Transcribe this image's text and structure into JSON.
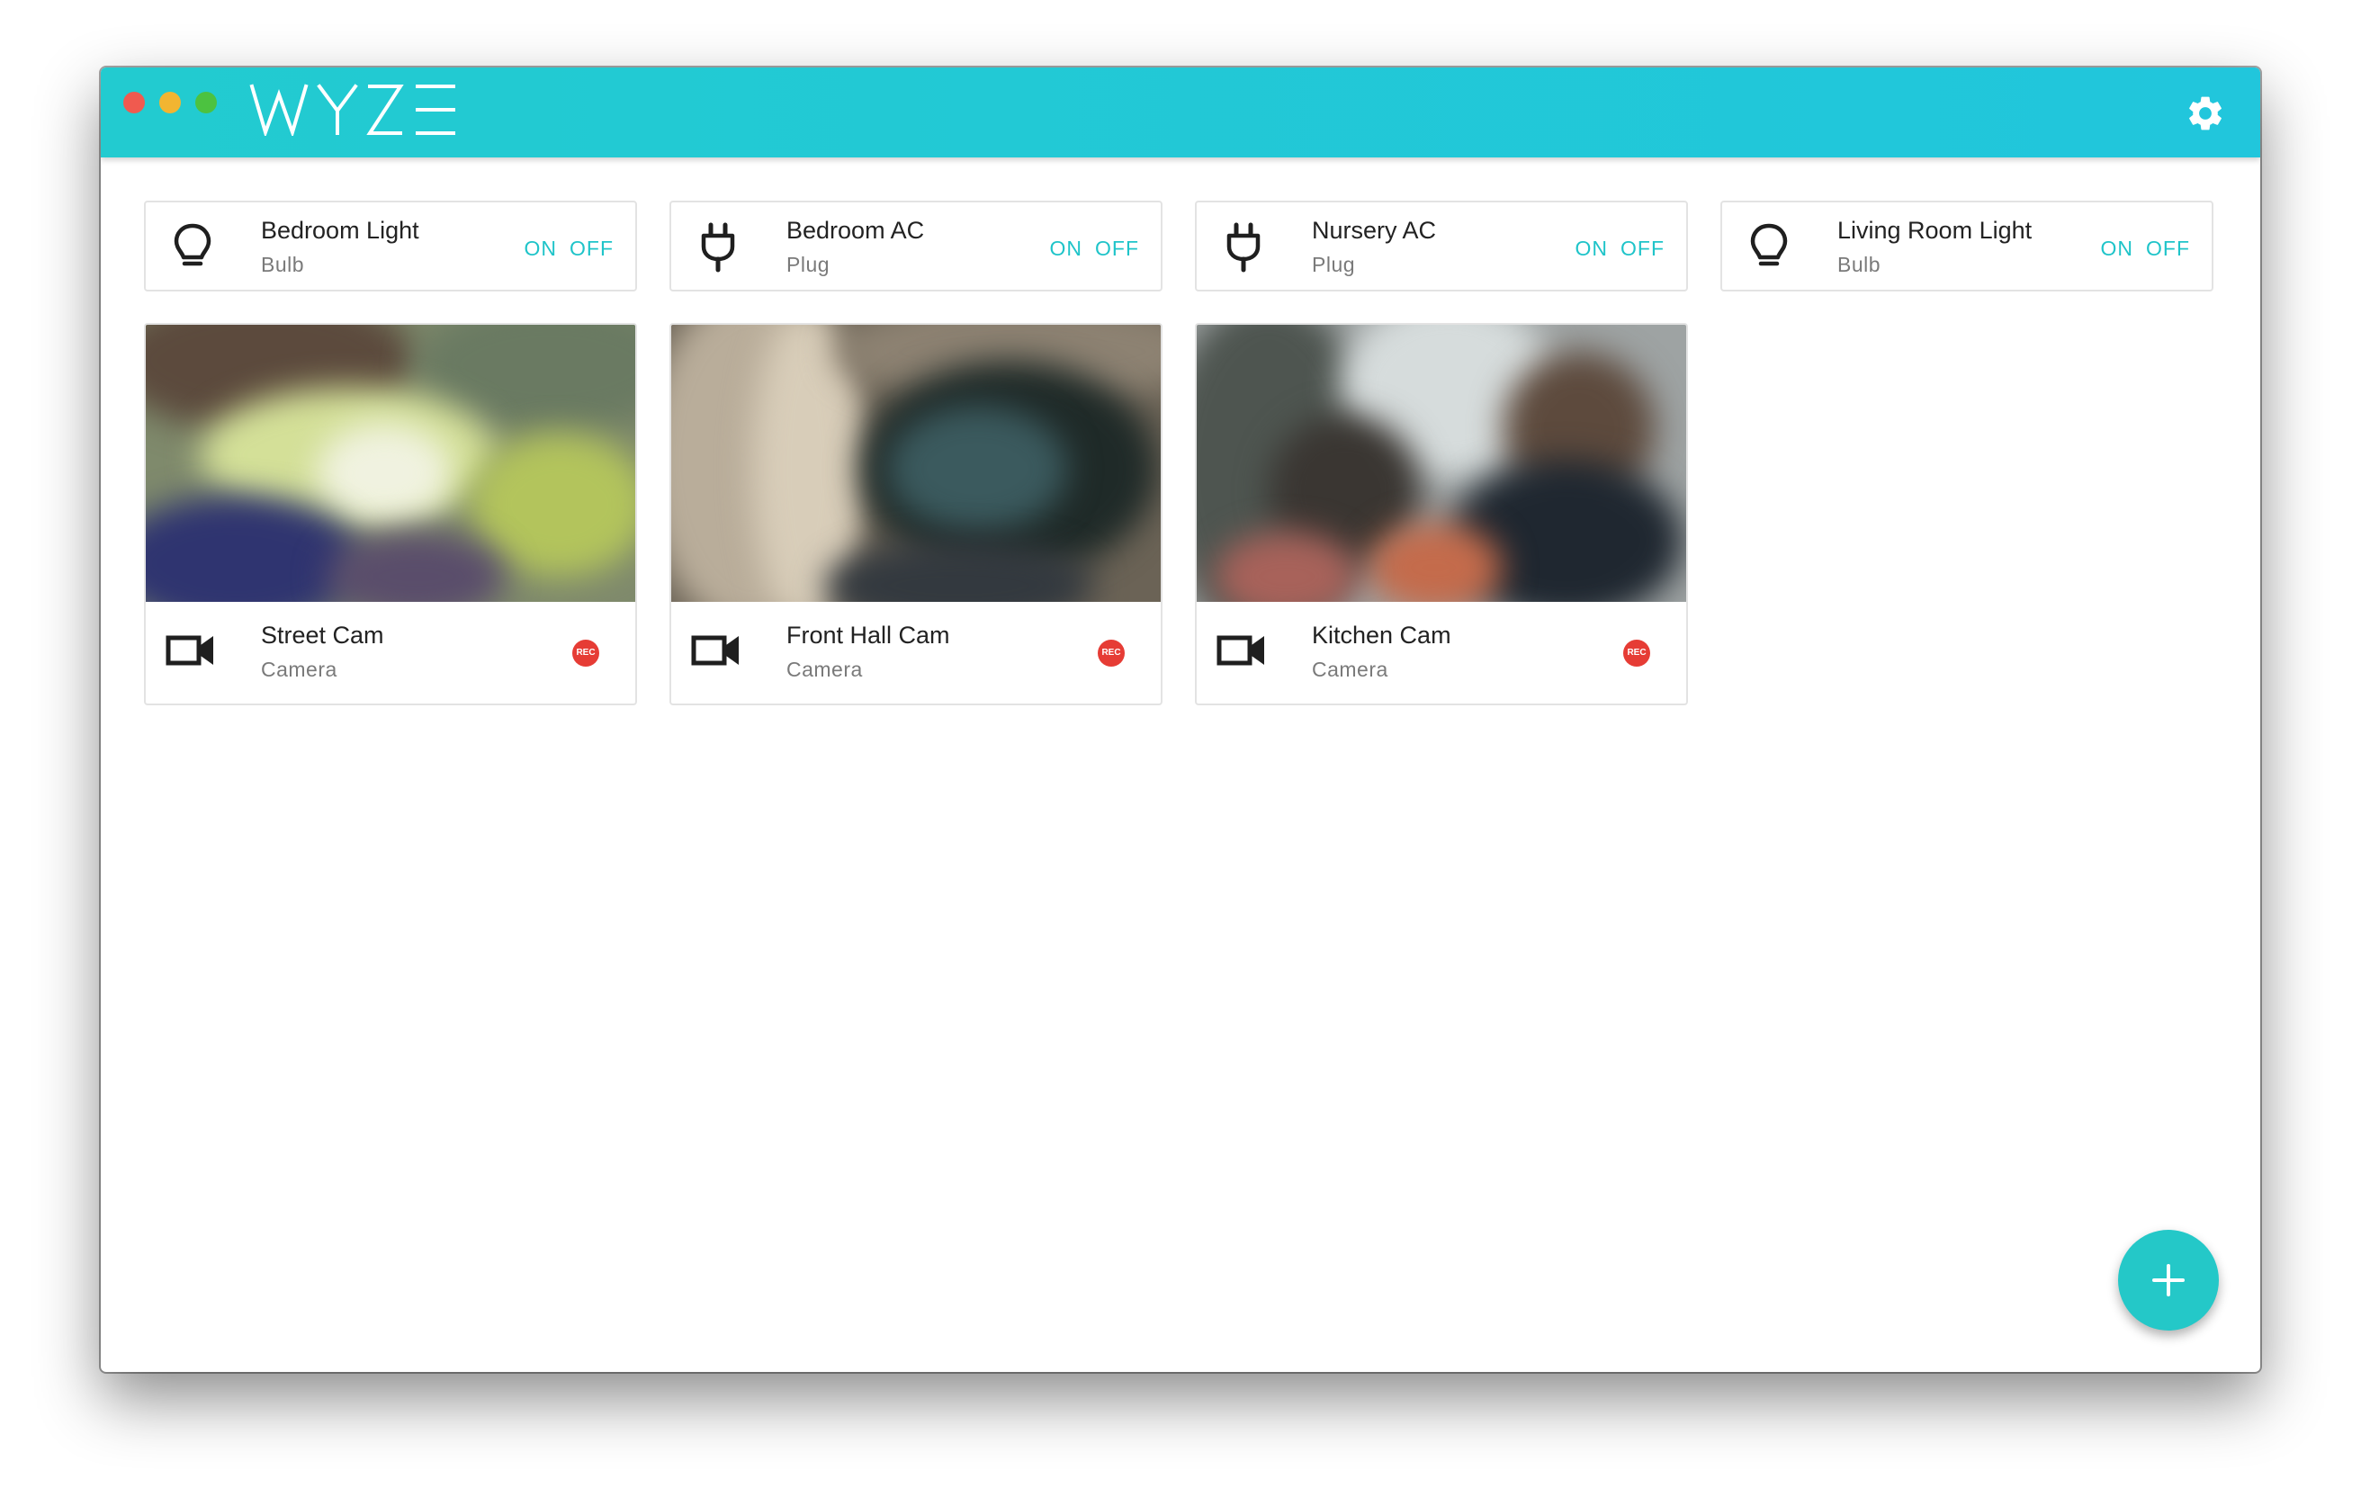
{
  "app": {
    "name": "WYZE"
  },
  "colors": {
    "accent": "#22cbd0",
    "toggle_text": "#1fc4c9",
    "rec": "#e63c35",
    "fab": "#24c8c8"
  },
  "header": {
    "settings_icon": "gear-icon"
  },
  "devices": [
    {
      "name": "Bedroom Light",
      "type": "Bulb",
      "icon": "lightbulb-icon",
      "on_label": "ON",
      "off_label": "OFF"
    },
    {
      "name": "Bedroom AC",
      "type": "Plug",
      "icon": "plug-icon",
      "on_label": "ON",
      "off_label": "OFF"
    },
    {
      "name": "Nursery AC",
      "type": "Plug",
      "icon": "plug-icon",
      "on_label": "ON",
      "off_label": "OFF"
    },
    {
      "name": "Living Room Light",
      "type": "Bulb",
      "icon": "lightbulb-icon",
      "on_label": "ON",
      "off_label": "OFF"
    }
  ],
  "cameras": [
    {
      "name": "Street Cam",
      "type": "Camera",
      "icon": "videocam-icon",
      "rec_label": "REC"
    },
    {
      "name": "Front Hall Cam",
      "type": "Camera",
      "icon": "videocam-icon",
      "rec_label": "REC"
    },
    {
      "name": "Kitchen Cam",
      "type": "Camera",
      "icon": "videocam-icon",
      "rec_label": "REC"
    }
  ],
  "fab": {
    "icon": "plus-icon"
  }
}
